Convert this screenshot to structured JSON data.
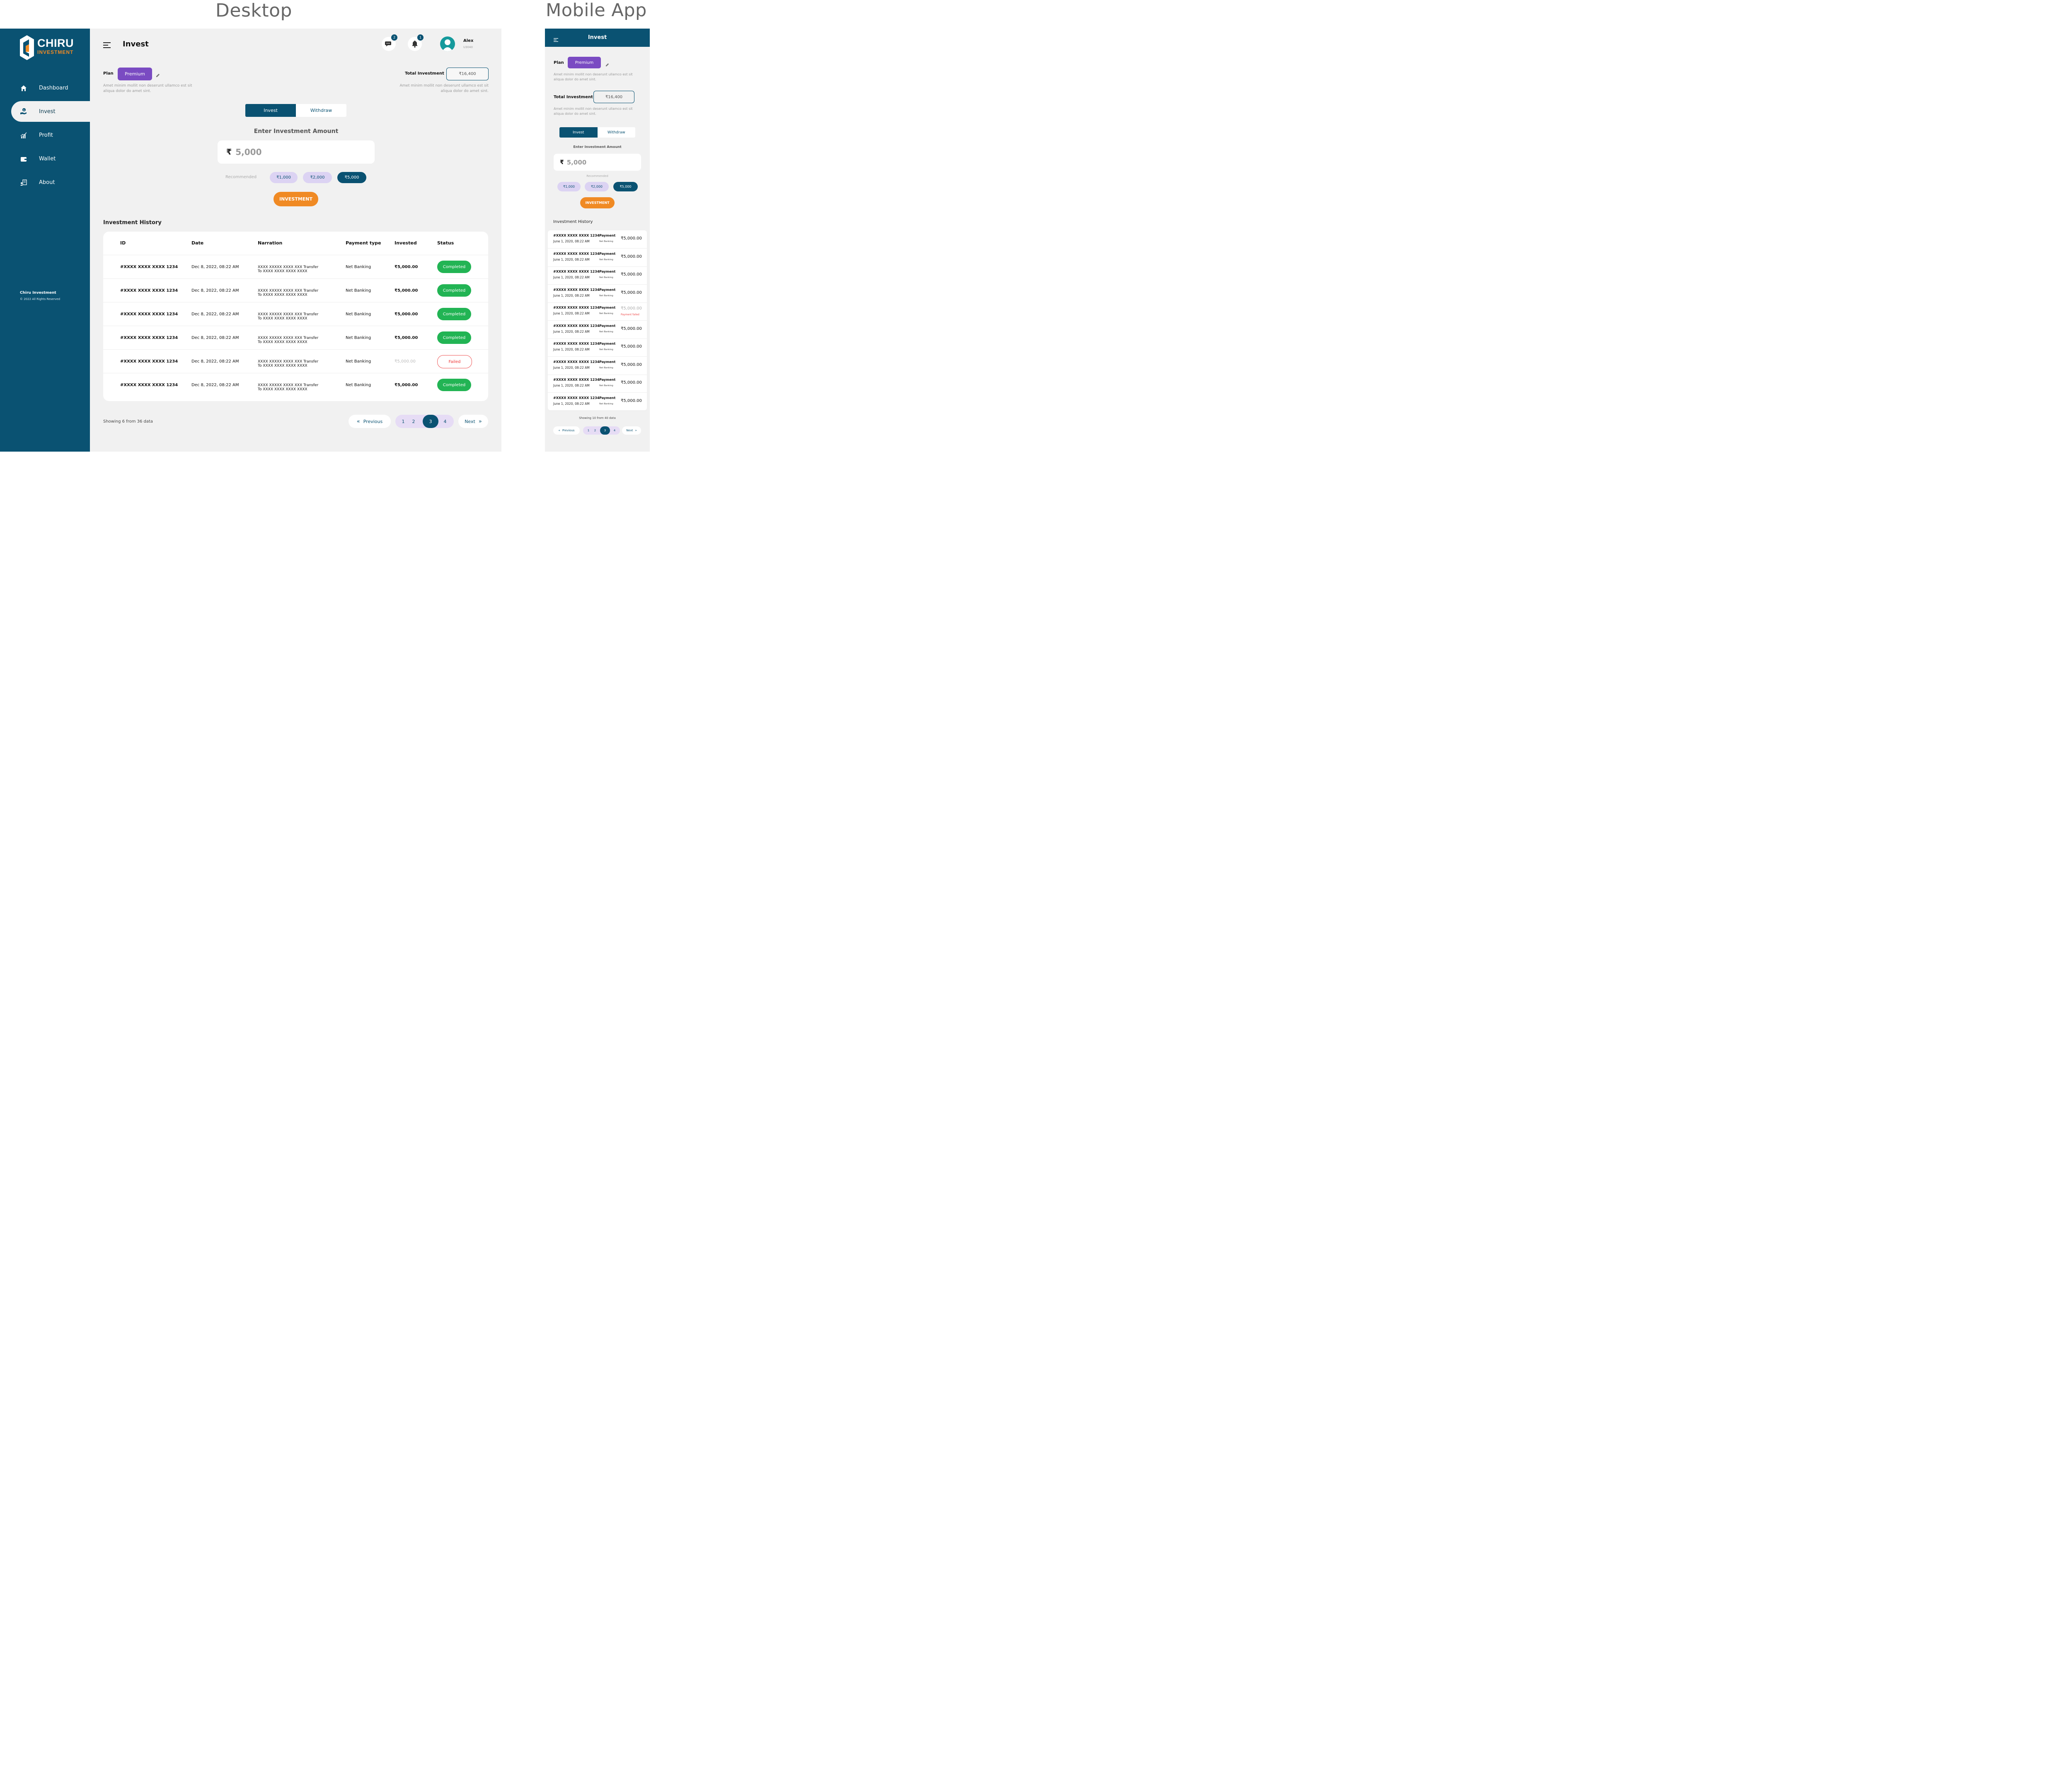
{
  "sections": {
    "desktop": "Desktop",
    "mobile": "Mobile App"
  },
  "colors": {
    "primary": "#0a5272",
    "accent": "#f08a24",
    "plan": "#7a4bc2",
    "success": "#22b454",
    "danger": "#e33333",
    "chip_light": "#dcd3f3"
  },
  "brand": {
    "name": "CHIRU",
    "tagline": "INVESTMENT"
  },
  "sidebar": {
    "items": [
      {
        "label": "Dashboard",
        "icon": "home-icon"
      },
      {
        "label": "Invest",
        "icon": "invest-hand-icon",
        "active": true
      },
      {
        "label": "Profit",
        "icon": "chart-growth-icon"
      },
      {
        "label": "Wallet",
        "icon": "wallet-icon"
      },
      {
        "label": "About",
        "icon": "about-icon"
      }
    ],
    "footer_title": "Chiru Investment",
    "footer_copy": "© 2022 All Rights Reserved"
  },
  "header": {
    "title": "Invest",
    "messages_count": "2",
    "notifications_count": "1",
    "user_name": "Alex",
    "user_id": "U3040"
  },
  "plan": {
    "label": "Plan",
    "value": "Premium",
    "desc": "Amet minim mollit non deserunt ullamco est sit aliqua dolor do amet sint."
  },
  "total": {
    "label": "Total Investment",
    "value": "₹16,400",
    "desc": "Amet minim mollit non deserunt ullamco est sit aliqua dolor do amet sint."
  },
  "tabs": {
    "invest": "Invest",
    "withdraw": "Withdraw"
  },
  "amount": {
    "label": "Enter Investment Amount",
    "currency": "₹",
    "value": "5,000"
  },
  "recommended": {
    "label": "Recommended",
    "options": [
      "₹1,000",
      "₹2,000",
      "₹5,000"
    ],
    "selected": "₹5,000"
  },
  "invest_button": "INVESTMENT",
  "history": {
    "title": "Investment History",
    "columns": [
      "ID",
      "Date",
      "Narration",
      "Payment type",
      "Invested",
      "Status"
    ],
    "rows": [
      {
        "id": "#XXXX XXXX XXXX 1234",
        "date": "Dec 8, 2022, 08:22 AM",
        "narration1": "XXXX XXXXX XXXX XXX Transfer",
        "narration2": "To XXXX XXXX XXXX XXXX",
        "type": "Net Banking",
        "amount": "₹5,000.00",
        "status": "Completed"
      },
      {
        "id": "#XXXX XXXX XXXX 1234",
        "date": "Dec 8, 2022, 08:22 AM",
        "narration1": "XXXX XXXXX XXXX XXX Transfer",
        "narration2": "To XXXX XXXX XXXX XXXX",
        "type": "Net Banking",
        "amount": "₹5,000.00",
        "status": "Completed"
      },
      {
        "id": "#XXXX XXXX XXXX 1234",
        "date": "Dec 8, 2022, 08:22 AM",
        "narration1": "XXXX XXXXX XXXX XXX Transfer",
        "narration2": "To XXXX XXXX XXXX XXXX",
        "type": "Net Banking",
        "amount": "₹5,000.00",
        "status": "Completed"
      },
      {
        "id": "#XXXX XXXX XXXX 1234",
        "date": "Dec 8, 2022, 08:22 AM",
        "narration1": "XXXX XXXXX XXXX XXX Transfer",
        "narration2": "To XXXX XXXX XXXX XXXX",
        "type": "Net Banking",
        "amount": "₹5,000.00",
        "status": "Completed"
      },
      {
        "id": "#XXXX XXXX XXXX 1234",
        "date": "Dec 8, 2022, 08:22 AM",
        "narration1": "XXXX XXXXX XXXX XXX Transfer",
        "narration2": "To XXXX XXXX XXXX XXXX",
        "type": "Net Banking",
        "amount": "₹5,000.00",
        "status": "Failed"
      },
      {
        "id": "#XXXX XXXX XXXX 1234",
        "date": "Dec 8, 2022, 08:22 AM",
        "narration1": "XXXX XXXXX XXXX XXX Transfer",
        "narration2": "To XXXX XXXX XXXX XXXX",
        "type": "Net Banking",
        "amount": "₹5,000.00",
        "status": "Completed"
      }
    ]
  },
  "pagination": {
    "showing": "Showing 6 from 36 data",
    "previous": "Previous",
    "next": "Next",
    "pages": [
      "1",
      "2",
      "3",
      "4"
    ],
    "current": "3"
  },
  "mobile": {
    "title": "Invest",
    "plan_label": "Plan",
    "plan_value": "Premium",
    "plan_desc": "Amet minim mollit non deserunt ullamco est sit aliqua dolor do amet sint.",
    "total_label": "Total Investment",
    "total_value": "₹16,400",
    "total_desc": "Amet minim mollit non deserunt ullamco est sit aliqua dolor do amet sint.",
    "tab_invest": "Invest",
    "tab_withdraw": "Withdraw",
    "amount_label": "Enter Investment Amount",
    "currency": "₹",
    "amount_value": "5,000",
    "recommended": "Recommended",
    "chips": [
      "₹1,000",
      "₹2,000",
      "₹5,000"
    ],
    "invest_button": "INVESTMENT",
    "history_title": "Investment History",
    "rows": [
      {
        "id": "#XXXX XXXX XXXX 1234",
        "date": "June 1, 2020, 08:22 AM",
        "pay": "Payment",
        "type": "Net Banking",
        "amount": "₹5,000.00"
      },
      {
        "id": "#XXXX XXXX XXXX 1234",
        "date": "June 1, 2020, 08:22 AM",
        "pay": "Payment",
        "type": "Net Banking",
        "amount": "₹5,000.00"
      },
      {
        "id": "#XXXX XXXX XXXX 1234",
        "date": "June 1, 2020, 08:22 AM",
        "pay": "Payment",
        "type": "Net Banking",
        "amount": "₹5,000.00"
      },
      {
        "id": "#XXXX XXXX XXXX 1234",
        "date": "June 1, 2020, 08:22 AM",
        "pay": "Payment",
        "type": "Net Banking",
        "amount": "₹5,000.00"
      },
      {
        "id": "#XXXX XXXX XXXX 1234",
        "date": "June 1, 2020, 08:22 AM",
        "pay": "Payment",
        "type": "Net Banking",
        "amount": "₹5,000.00",
        "failed": "Payment failed"
      },
      {
        "id": "#XXXX XXXX XXXX 1234",
        "date": "June 1, 2020, 08:22 AM",
        "pay": "Payment",
        "type": "Net Banking",
        "amount": "₹5,000.00"
      },
      {
        "id": "#XXXX XXXX XXXX 1234",
        "date": "June 1, 2020, 08:22 AM",
        "pay": "Payment",
        "type": "Net Banking",
        "amount": "₹5,000.00"
      },
      {
        "id": "#XXXX XXXX XXXX 1234",
        "date": "June 1, 2020, 08:22 AM",
        "pay": "Payment",
        "type": "Net Banking",
        "amount": "₹5,000.00"
      },
      {
        "id": "#XXXX XXXX XXXX 1234",
        "date": "June 1, 2020, 08:22 AM",
        "pay": "Payment",
        "type": "Net Banking",
        "amount": "₹5,000.00"
      },
      {
        "id": "#XXXX XXXX XXXX 1234",
        "date": "June 1, 2020, 08:22 AM",
        "pay": "Payment",
        "type": "Net Banking",
        "amount": "₹5,000.00"
      }
    ],
    "showing": "Showing 10 from 40 data",
    "previous": "Previous",
    "next": "Next",
    "pages": [
      "1",
      "2",
      "3",
      "4"
    ],
    "current": "3"
  }
}
